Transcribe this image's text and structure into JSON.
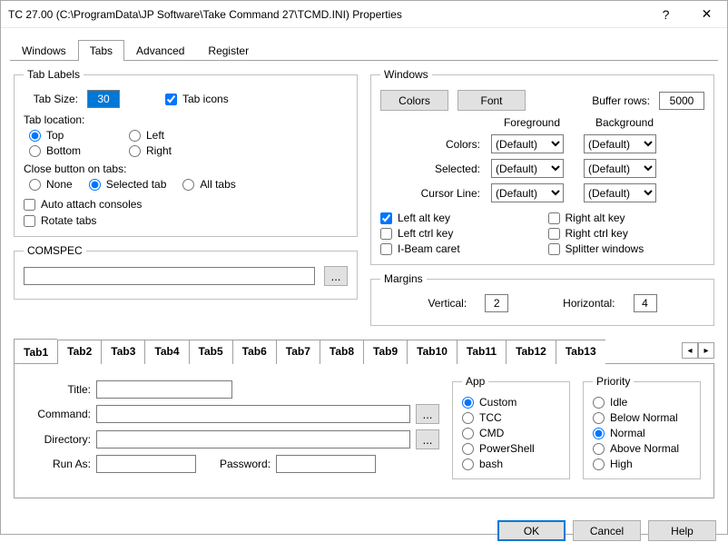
{
  "title": "TC 27.00  (C:\\ProgramData\\JP Software\\Take Command 27\\TCMD.INI)  Properties",
  "mainTabs": {
    "t0": "Windows",
    "t1": "Tabs",
    "t2": "Advanced",
    "t3": "Register"
  },
  "tabLabels": {
    "legend": "Tab Labels",
    "tabSizeLabel": "Tab Size:",
    "tabSizeValue": "30",
    "tabIcons": "Tab icons",
    "locationLabel": "Tab location:",
    "loc": {
      "top": "Top",
      "left": "Left",
      "bottom": "Bottom",
      "right": "Right"
    },
    "closeLabel": "Close button on tabs:",
    "close": {
      "none": "None",
      "sel": "Selected tab",
      "all": "All tabs"
    },
    "auto": "Auto attach consoles",
    "rotate": "Rotate tabs"
  },
  "comspec": {
    "legend": "COMSPEC",
    "value": "",
    "browse": "..."
  },
  "windows": {
    "legend": "Windows",
    "colorsBtn": "Colors",
    "fontBtn": "Font",
    "bufferLabel": "Buffer rows:",
    "bufferValue": "5000",
    "fg": "Foreground",
    "bg": "Background",
    "r1": "Colors:",
    "r2": "Selected:",
    "r3": "Cursor Line:",
    "def": "(Default)",
    "chk": {
      "lalt": "Left alt key",
      "ralt": "Right alt key",
      "lctrl": "Left ctrl key",
      "rctrl": "Right ctrl key",
      "ibeam": "I-Beam caret",
      "split": "Splitter windows"
    }
  },
  "margins": {
    "legend": "Margins",
    "vlabel": "Vertical:",
    "v": "2",
    "hlabel": "Horizontal:",
    "h": "4"
  },
  "innerTabs": {
    "t1": "Tab1",
    "t2": "Tab2",
    "t3": "Tab3",
    "t4": "Tab4",
    "t5": "Tab5",
    "t6": "Tab6",
    "t7": "Tab7",
    "t8": "Tab8",
    "t9": "Tab9",
    "t10": "Tab10",
    "t11": "Tab11",
    "t12": "Tab12",
    "t13": "Tab13"
  },
  "tab1": {
    "title": "Title:",
    "command": "Command:",
    "directory": "Directory:",
    "runas": "Run As:",
    "password": "Password:",
    "browse": "...",
    "app": {
      "legend": "App",
      "custom": "Custom",
      "tcc": "TCC",
      "cmd": "CMD",
      "ps": "PowerShell",
      "bash": "bash"
    },
    "priority": {
      "legend": "Priority",
      "idle": "Idle",
      "below": "Below Normal",
      "normal": "Normal",
      "above": "Above Normal",
      "high": "High"
    }
  },
  "footer": {
    "ok": "OK",
    "cancel": "Cancel",
    "help": "Help"
  },
  "scroll": {
    "left": "◂",
    "right": "▸"
  }
}
